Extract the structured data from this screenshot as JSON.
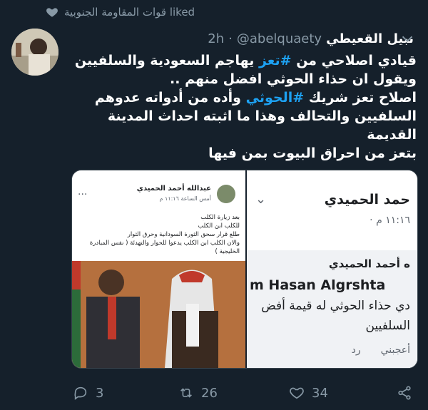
{
  "liked_bar": {
    "text": "قوات المقاومة الجنوبية liked"
  },
  "tweet": {
    "author_name": "نبيل القعيطي",
    "handle": "@abelquaety",
    "separator": "·",
    "time": "2h",
    "text": {
      "l1_a": "قيادي اصلاحي من ",
      "l1_tag": "#تعز",
      "l1_b": " يهاجم السعودية والسلفيين",
      "l2": "ويقول ان حذاء الحوثي افضل منهم ..",
      "l3_a": "اصلاح تعز شريك ",
      "l3_tag": "#الحوثي",
      "l3_b": " وأده من أدواته عدوهم",
      "l4": "السلفيين والتحالف وهذا ما اثبته احداث المدينة القديمة",
      "l5": "بتعز من احراق البيوت بمن فيها"
    }
  },
  "media_left": {
    "name": "عبدالله أحمد الحميدي",
    "time": "أمس الساعة ١١:١٦ م",
    "more": "...",
    "post_lines": [
      "بعد زيارة الكلب",
      "للكلب ابن الكلب",
      "طلع قرار سحق الثورة السودانية وحرق الثوار",
      "والان الكلب ابن الكلب يدعوا للحوار والتهدئة ( نفس المبادرة",
      "الخليجية )"
    ]
  },
  "media_right": {
    "name": "حمد الحميدي",
    "time": "١١:١٦ م ·",
    "reply_name": "ه أحمد الحميدي",
    "reply_en": "m Hasan Algrshta",
    "line1": "دي حذاء الحوثي له قيمة أفض",
    "line2": "السلفيين",
    "action_like": "أعجبني",
    "action_reply": "رد"
  },
  "actions": {
    "replies": "3",
    "retweets": "26",
    "likes": "34"
  },
  "colors": {
    "background": "#15202b",
    "accent": "#1da1f2",
    "muted": "#8899a6"
  }
}
